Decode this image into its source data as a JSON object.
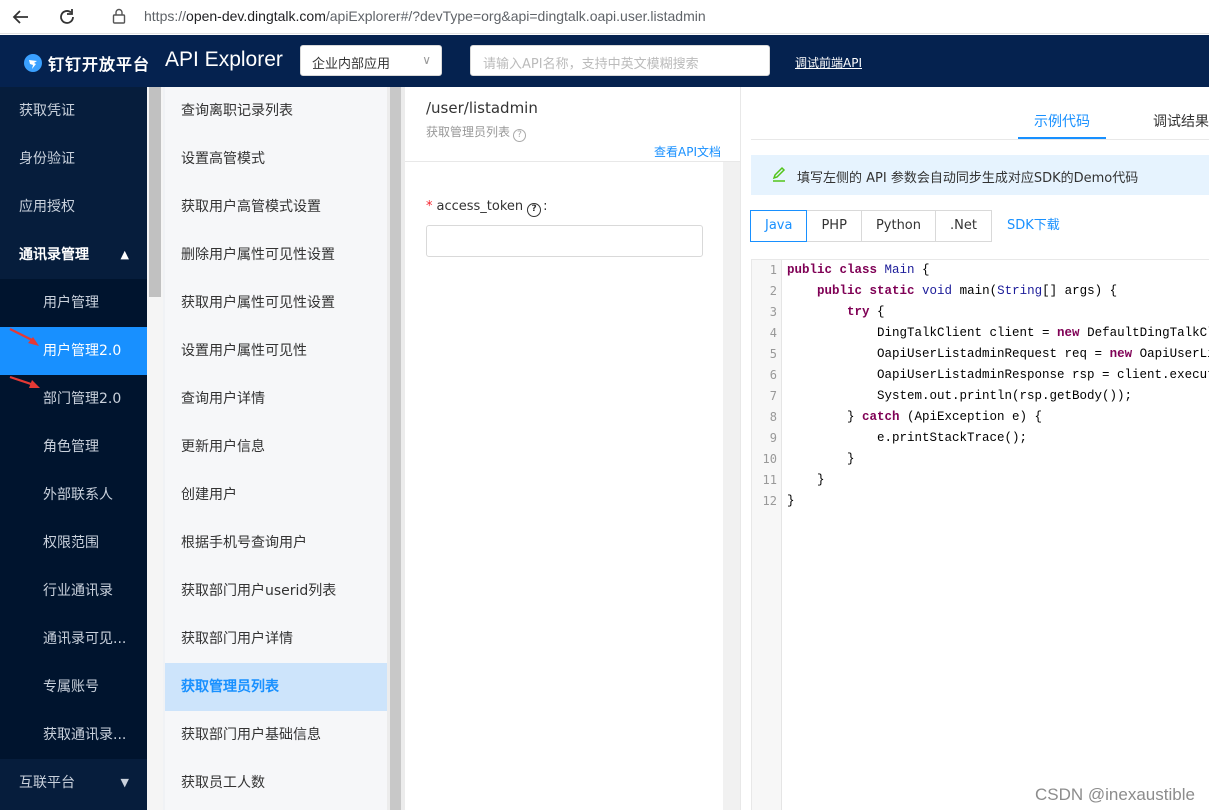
{
  "browser": {
    "url_prefix": "https://",
    "url_host": "open-dev.dingtalk.com",
    "url_path": "/apiExplorer#/?devType=org&api=dingtalk.oapi.user.listadmin"
  },
  "header": {
    "logo_text": "钉钉开放平台",
    "title": "API Explorer",
    "scope_select": "企业内部应用",
    "search_placeholder": "请输入API名称，支持中英文模糊搜索",
    "debug_link": "调试前端API"
  },
  "sidebar": {
    "items": [
      {
        "label": "获取凭证"
      },
      {
        "label": "身份验证"
      },
      {
        "label": "应用授权"
      },
      {
        "label": "通讯录管理"
      },
      {
        "label": "用户管理"
      },
      {
        "label": "用户管理2.0"
      },
      {
        "label": "部门管理2.0"
      },
      {
        "label": "角色管理"
      },
      {
        "label": "外部联系人"
      },
      {
        "label": "权限范围"
      },
      {
        "label": "行业通讯录"
      },
      {
        "label": "通讯录可见..."
      },
      {
        "label": "专属账号"
      },
      {
        "label": "获取通讯录..."
      },
      {
        "label": "互联平台"
      }
    ]
  },
  "api_list": {
    "items": [
      {
        "label": "查询离职记录列表"
      },
      {
        "label": "设置高管模式"
      },
      {
        "label": "获取用户高管模式设置"
      },
      {
        "label": "删除用户属性可见性设置"
      },
      {
        "label": "获取用户属性可见性设置"
      },
      {
        "label": "设置用户属性可见性"
      },
      {
        "label": "查询用户详情"
      },
      {
        "label": "更新用户信息"
      },
      {
        "label": "创建用户"
      },
      {
        "label": "根据手机号查询用户"
      },
      {
        "label": "获取部门用户userid列表"
      },
      {
        "label": "获取部门用户详情"
      },
      {
        "label": "获取管理员列表"
      },
      {
        "label": "获取部门用户基础信息"
      },
      {
        "label": "获取员工人数"
      }
    ],
    "selected": "获取管理员列表"
  },
  "params": {
    "api_path": "/user/listadmin",
    "api_desc": "获取管理员列表",
    "doc_link": "查看API文档",
    "fields": [
      {
        "required": "*",
        "name": "access_token",
        "help": "?",
        "suffix": ":",
        "value": ""
      }
    ]
  },
  "code_panel": {
    "tabs": [
      "示例代码",
      "调试结果"
    ],
    "active_tab": "示例代码",
    "tip": "填写左侧的 API 参数会自动同步生成对应SDK的Demo代码",
    "languages": [
      "Java",
      "PHP",
      "Python",
      ".Net"
    ],
    "active_language": "Java",
    "sdk_link": "SDK下载",
    "line_numbers": [
      "1",
      "2",
      "3",
      "4",
      "5",
      "6",
      "7",
      "8",
      "9",
      "10",
      "11",
      "12"
    ]
  },
  "colors": {
    "header_bg": "#05224f",
    "sidebar_bg": "#061d3c",
    "accent": "#1890ff",
    "selected_bg": "#cde4fb"
  },
  "watermark": "CSDN @inexaustible"
}
